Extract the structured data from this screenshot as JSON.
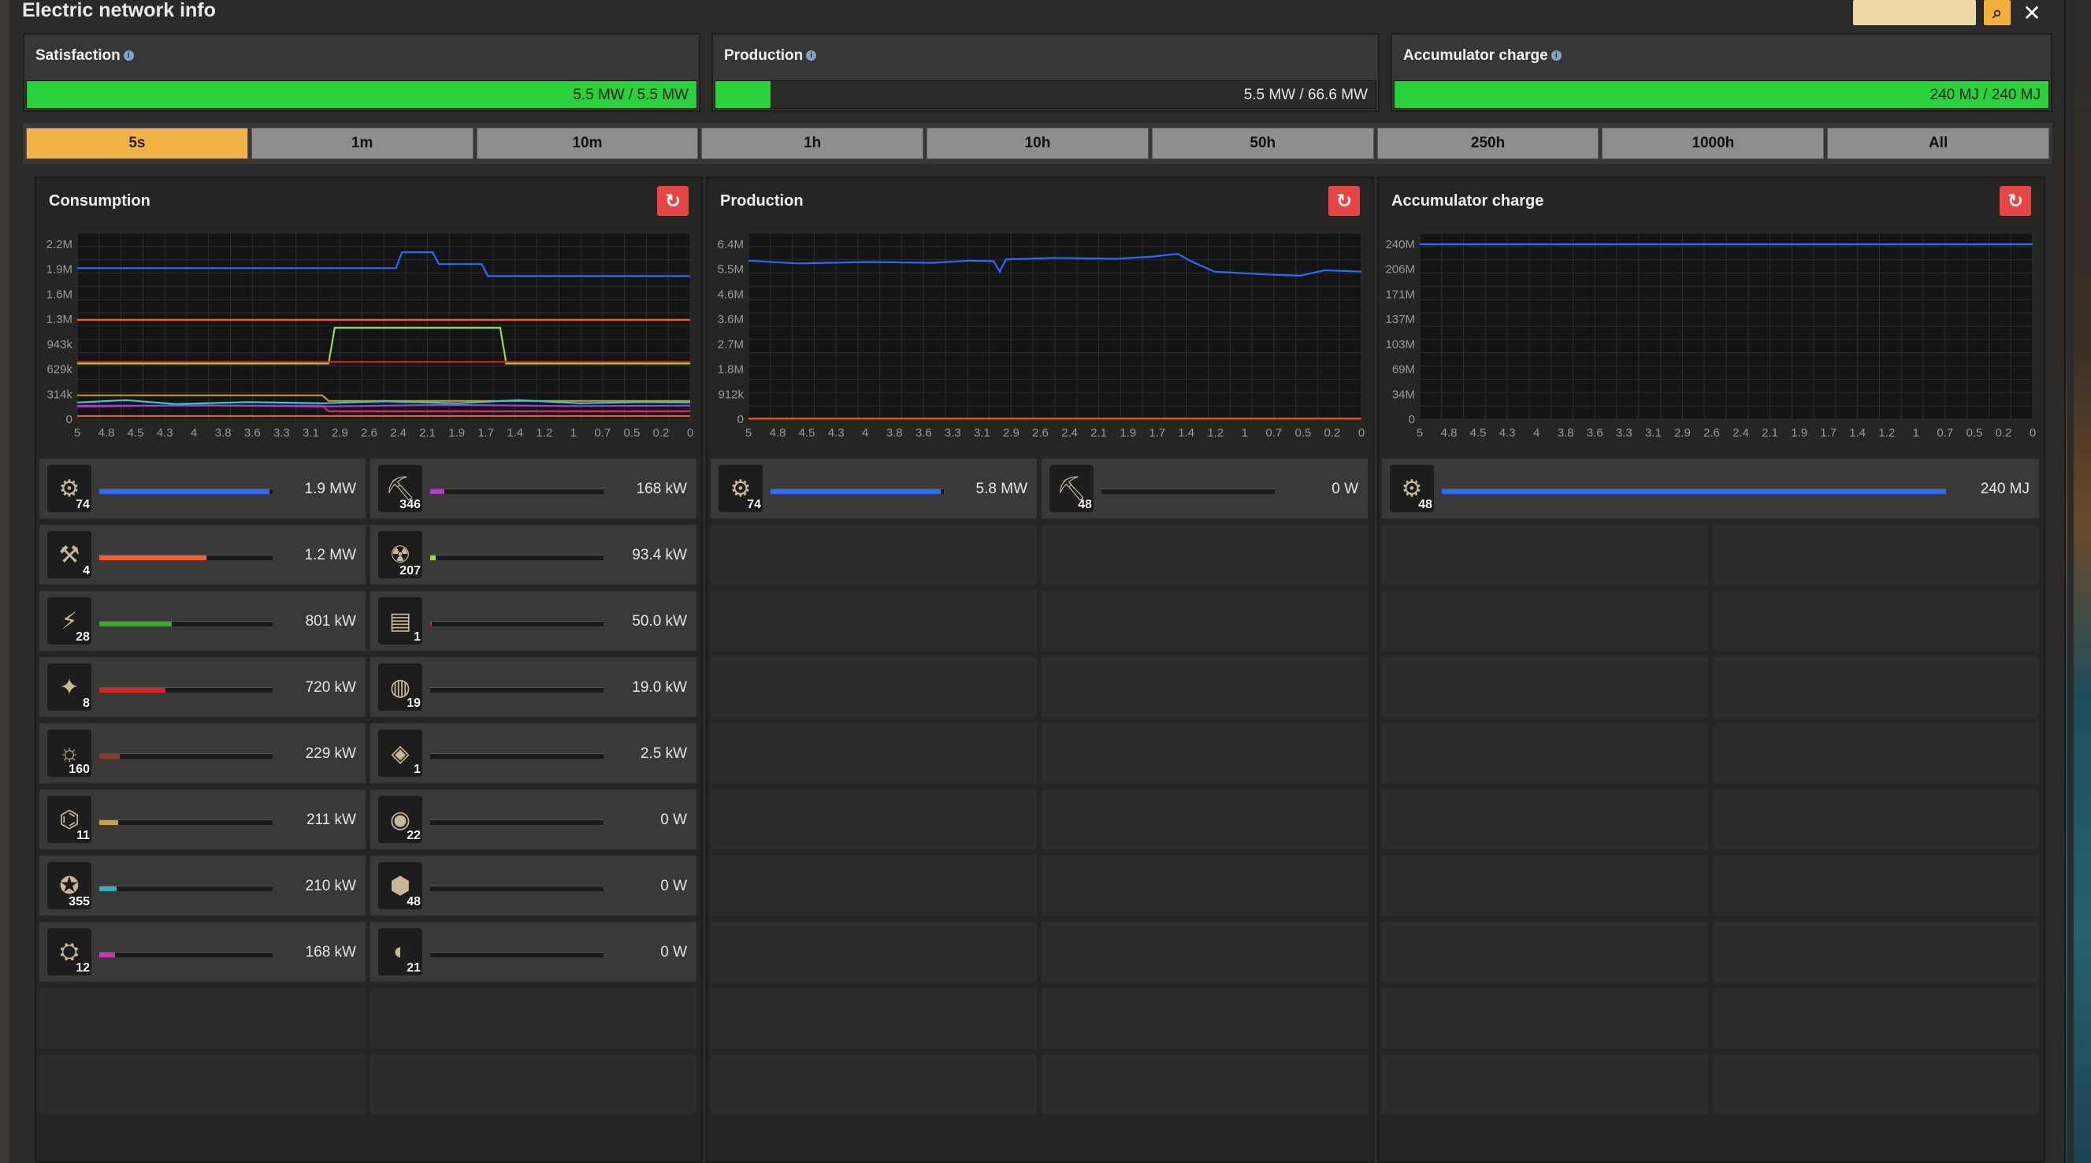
{
  "window": {
    "title": "Electric network info"
  },
  "summary": [
    {
      "label": "Satisfaction",
      "value_text": "5.5 MW / 5.5 MW",
      "fill": 1.0
    },
    {
      "label": "Production",
      "value_text": "5.5 MW / 66.6 MW",
      "fill": 0.083
    },
    {
      "label": "Accumulator charge",
      "value_text": "240 MJ / 240 MJ",
      "fill": 1.0
    }
  ],
  "time_ranges": [
    "5s",
    "1m",
    "10m",
    "1h",
    "10h",
    "50h",
    "250h",
    "1000h",
    "All"
  ],
  "selected_time_range": "5s",
  "x_ticks": [
    "5",
    "4.8",
    "4.5",
    "4.3",
    "4",
    "3.8",
    "3.6",
    "3.3",
    "3.1",
    "2.9",
    "2.6",
    "2.4",
    "2.1",
    "1.9",
    "1.7",
    "1.4",
    "1.2",
    "1",
    "0.7",
    "0.5",
    "0.2",
    "0"
  ],
  "panels": {
    "consumption": {
      "title": "Consumption",
      "y_ticks": [
        "2.2M",
        "1.9M",
        "1.6M",
        "1.3M",
        "943k",
        "629k",
        "314k",
        "0"
      ],
      "ymax": 2200000,
      "series": [
        {
          "color": "#2a6bff",
          "points": [
            [
              5,
              1900000
            ],
            [
              2.4,
              1900000
            ],
            [
              2.35,
              2100000
            ],
            [
              2.1,
              2100000
            ],
            [
              2.05,
              1950000
            ],
            [
              1.7,
              1950000
            ],
            [
              1.65,
              1800000
            ],
            [
              0,
              1800000
            ]
          ]
        },
        {
          "color": "#ff5a2a",
          "points": [
            [
              5,
              1250000
            ],
            [
              0,
              1250000
            ]
          ]
        },
        {
          "color": "#9adb3a",
          "points": [
            [
              5,
              700000
            ],
            [
              2.95,
              700000
            ],
            [
              2.9,
              1150000
            ],
            [
              1.55,
              1150000
            ],
            [
              1.5,
              700000
            ],
            [
              0,
              700000
            ]
          ]
        },
        {
          "color": "#e02020",
          "points": [
            [
              5,
              720000
            ],
            [
              0,
              720000
            ]
          ]
        },
        {
          "color": "#c8952a",
          "points": [
            [
              5,
              300000
            ],
            [
              3.0,
              300000
            ],
            [
              2.95,
              230000
            ],
            [
              0,
              230000
            ]
          ]
        },
        {
          "color": "#e02080",
          "points": [
            [
              5,
              170000
            ],
            [
              3.0,
              170000
            ],
            [
              2.95,
              100000
            ],
            [
              0,
              100000
            ]
          ]
        },
        {
          "color": "#2fd0d0",
          "points": [
            [
              5,
              210000
            ],
            [
              4.6,
              240000
            ],
            [
              4.2,
              190000
            ],
            [
              3.6,
              215000
            ],
            [
              3.0,
              200000
            ],
            [
              2.5,
              225000
            ],
            [
              1.9,
              200000
            ],
            [
              1.4,
              240000
            ],
            [
              0.9,
              200000
            ],
            [
              0.4,
              215000
            ],
            [
              0,
              210000
            ]
          ]
        },
        {
          "color": "#a040e0",
          "points": [
            [
              5,
              160000
            ],
            [
              4.0,
              175000
            ],
            [
              3.0,
              160000
            ],
            [
              2.0,
              180000
            ],
            [
              1.0,
              165000
            ],
            [
              0,
              170000
            ]
          ]
        },
        {
          "color": "#c86c2a",
          "points": [
            [
              5,
              40000
            ],
            [
              0,
              40000
            ]
          ]
        }
      ],
      "rows": [
        [
          {
            "count": "74",
            "value": "1.9 MW",
            "fill": 0.98,
            "color": "#2a6bff"
          },
          {
            "count": "346",
            "value": "168 kW",
            "fill": 0.08,
            "color": "#b33ad8"
          }
        ],
        [
          {
            "count": "4",
            "value": "1.2 MW",
            "fill": 0.62,
            "color": "#ff5a2a"
          },
          {
            "count": "207",
            "value": "93.4 kW",
            "fill": 0.03,
            "color": "#9adb3a"
          }
        ],
        [
          {
            "count": "28",
            "value": "801 kW",
            "fill": 0.42,
            "color": "#3aaa2a"
          },
          {
            "count": "1",
            "value": "50.0 kW",
            "fill": 0.01,
            "color": "#e02020"
          }
        ],
        [
          {
            "count": "8",
            "value": "720 kW",
            "fill": 0.38,
            "color": "#e02020"
          },
          {
            "count": "19",
            "value": "19.0 kW",
            "fill": 0.0,
            "color": "#888888"
          }
        ],
        [
          {
            "count": "160",
            "value": "229 kW",
            "fill": 0.12,
            "color": "#8a3a2a"
          },
          {
            "count": "1",
            "value": "2.5 kW",
            "fill": 0.0,
            "color": "#888888"
          }
        ],
        [
          {
            "count": "11",
            "value": "211 kW",
            "fill": 0.11,
            "color": "#d8a030"
          },
          {
            "count": "22",
            "value": "0 W",
            "fill": 0.0,
            "color": "#888888"
          }
        ],
        [
          {
            "count": "355",
            "value": "210 kW",
            "fill": 0.1,
            "color": "#2fb0c0"
          },
          {
            "count": "48",
            "value": "0 W",
            "fill": 0.0,
            "color": "#888888"
          }
        ],
        [
          {
            "count": "12",
            "value": "168 kW",
            "fill": 0.09,
            "color": "#d030c0"
          },
          {
            "count": "21",
            "value": "0 W",
            "fill": 0.0,
            "color": "#888888"
          }
        ]
      ]
    },
    "production": {
      "title": "Production",
      "y_ticks": [
        "6.4M",
        "5.5M",
        "4.6M",
        "3.6M",
        "2.7M",
        "1.8M",
        "912k",
        "0"
      ],
      "ymax": 6400000,
      "series": [
        {
          "color": "#2a6bff",
          "points": [
            [
              5,
              5800000
            ],
            [
              4.6,
              5700000
            ],
            [
              4.0,
              5750000
            ],
            [
              3.5,
              5720000
            ],
            [
              3.2,
              5800000
            ],
            [
              3.0,
              5780000
            ],
            [
              2.95,
              5400000
            ],
            [
              2.9,
              5850000
            ],
            [
              2.5,
              5900000
            ],
            [
              2.0,
              5870000
            ],
            [
              1.7,
              5950000
            ],
            [
              1.5,
              6050000
            ],
            [
              1.4,
              5800000
            ],
            [
              1.2,
              5400000
            ],
            [
              0.8,
              5300000
            ],
            [
              0.5,
              5250000
            ],
            [
              0.3,
              5450000
            ],
            [
              0,
              5400000
            ]
          ]
        },
        {
          "color": "#ff5a2a",
          "points": [
            [
              5,
              20000
            ],
            [
              0,
              20000
            ]
          ]
        }
      ],
      "rows": [
        [
          {
            "count": "74",
            "value": "5.8 MW",
            "fill": 0.98,
            "color": "#2a6bff"
          },
          {
            "count": "48",
            "value": "0 W",
            "fill": 0.0,
            "color": "#888888"
          }
        ]
      ]
    },
    "accumulator": {
      "title": "Accumulator charge",
      "y_ticks": [
        "240M",
        "206M",
        "171M",
        "137M",
        "103M",
        "69M",
        "34M",
        "0"
      ],
      "ymax": 240000000,
      "series": [
        {
          "color": "#2a6bff",
          "points": [
            [
              5,
              240000000
            ],
            [
              0,
              240000000
            ]
          ]
        }
      ],
      "rows": [
        [
          {
            "count": "48",
            "value": "240 MJ",
            "fill": 1.0,
            "color": "#2a6bff",
            "wide": true
          }
        ]
      ]
    }
  },
  "icons": {
    "search": "magnifier-icon",
    "close": "close-icon",
    "reset": "reset-icon",
    "info": "info-icon"
  }
}
